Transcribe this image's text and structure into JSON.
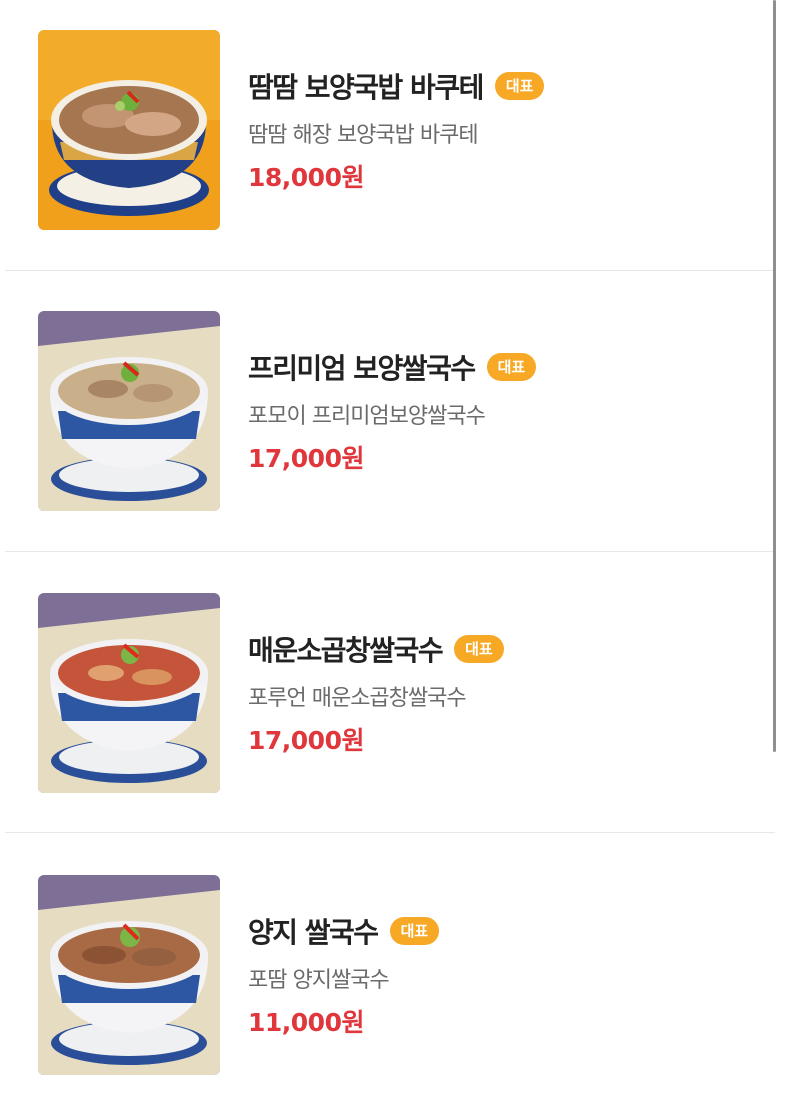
{
  "menu": {
    "items": [
      {
        "name": "땀땀 보양국밥 바쿠테",
        "badge": "대표",
        "description": "땀땀 해장 보양국밥 바쿠테",
        "price": "18,000원",
        "image_icon": "soup-bowl-image",
        "background_color": "#f0a01a",
        "soup_color": "#b98a62"
      },
      {
        "name": "프리미엄 보양쌀국수",
        "badge": "대표",
        "description": "포모이 프리미엄보양쌀국수",
        "price": "17,000원",
        "image_icon": "rice-noodle-bowl-image",
        "background_color": "#7d6f95",
        "soup_color": "#c9b08a"
      },
      {
        "name": "매운소곱창쌀국수",
        "badge": "대표",
        "description": "포루언 매운소곱창쌀국수",
        "price": "17,000원",
        "image_icon": "spicy-noodle-bowl-image",
        "background_color": "#7d6f95",
        "soup_color": "#c4553a"
      },
      {
        "name": "양지 쌀국수",
        "badge": "대표",
        "description": "포땀 양지쌀국수",
        "price": "11,000원",
        "image_icon": "beef-noodle-bowl-image",
        "background_color": "#7d6f95",
        "soup_color": "#a86a45"
      }
    ]
  },
  "colors": {
    "badge": "#f7a825",
    "price": "#e0373d",
    "name": "#222222",
    "description": "#6b6b6b"
  }
}
